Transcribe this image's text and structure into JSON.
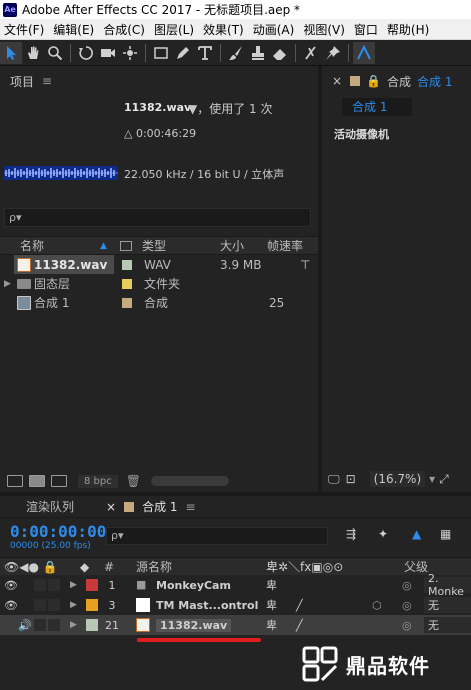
{
  "window": {
    "title": "Adobe After Effects CC 2017 - 无标题项目.aep *",
    "logo": "Ae"
  },
  "menu": [
    "文件(F)",
    "编辑(E)",
    "合成(C)",
    "图层(L)",
    "效果(T)",
    "动画(A)",
    "视图(V)",
    "窗口",
    "帮助(H)"
  ],
  "project_panel": {
    "title": "项目",
    "preview": {
      "name": "11382.wav",
      "usage": "▼，使用了 1 次",
      "duration": "△ 0:00:46:29",
      "format": "22.050 kHz / 16 bit U / 立体声"
    },
    "search_placeholder": "ρ▾",
    "columns": {
      "name": "名称",
      "type": "类型",
      "size": "大小",
      "rate": "帧速率"
    },
    "items": [
      {
        "name": "11382.wav",
        "type": "WAV",
        "size": "3.9 MB",
        "rate": "",
        "chip": "#b7c9b5",
        "icon": "audio-file-icon"
      },
      {
        "name": "固态层",
        "type": "文件夹",
        "size": "",
        "rate": "",
        "chip": "#e5cc5b",
        "icon": "folder-icon"
      },
      {
        "name": "合成 1",
        "type": "合成",
        "size": "",
        "rate": "25",
        "chip": "#c5a97f",
        "icon": "composition-icon"
      }
    ],
    "bit_depth": "8 bpc"
  },
  "comp_panel": {
    "header_prefix": "合成",
    "header_tab": "合成 1",
    "subtab": "合成 1",
    "camera_label": "活动摄像机",
    "zoom": "(16.7%)"
  },
  "timeline": {
    "tab_render": "渲染队列",
    "tab_comp": "合成 1",
    "timecode": "0:00:00:00",
    "fps": "00000 (25.00 fps)",
    "search_placeholder": "ρ▾",
    "header": {
      "num": "#",
      "source": "源名称",
      "parent": "父级"
    },
    "layers": [
      {
        "num": "1",
        "name": "MonkeyCam",
        "color": "#c83a3a",
        "icon": "camera-icon",
        "parent": "2. Monke"
      },
      {
        "num": "3",
        "name": "TM Mast...ontrol",
        "color": "#e8a020",
        "icon": "null-object-icon",
        "parent": "无"
      },
      {
        "num": "21",
        "name": "11382.wav",
        "color": "#b7c9b5",
        "icon": "audio-file-icon",
        "parent": "无"
      }
    ]
  },
  "watermark": {
    "text": "鼎品软件"
  }
}
